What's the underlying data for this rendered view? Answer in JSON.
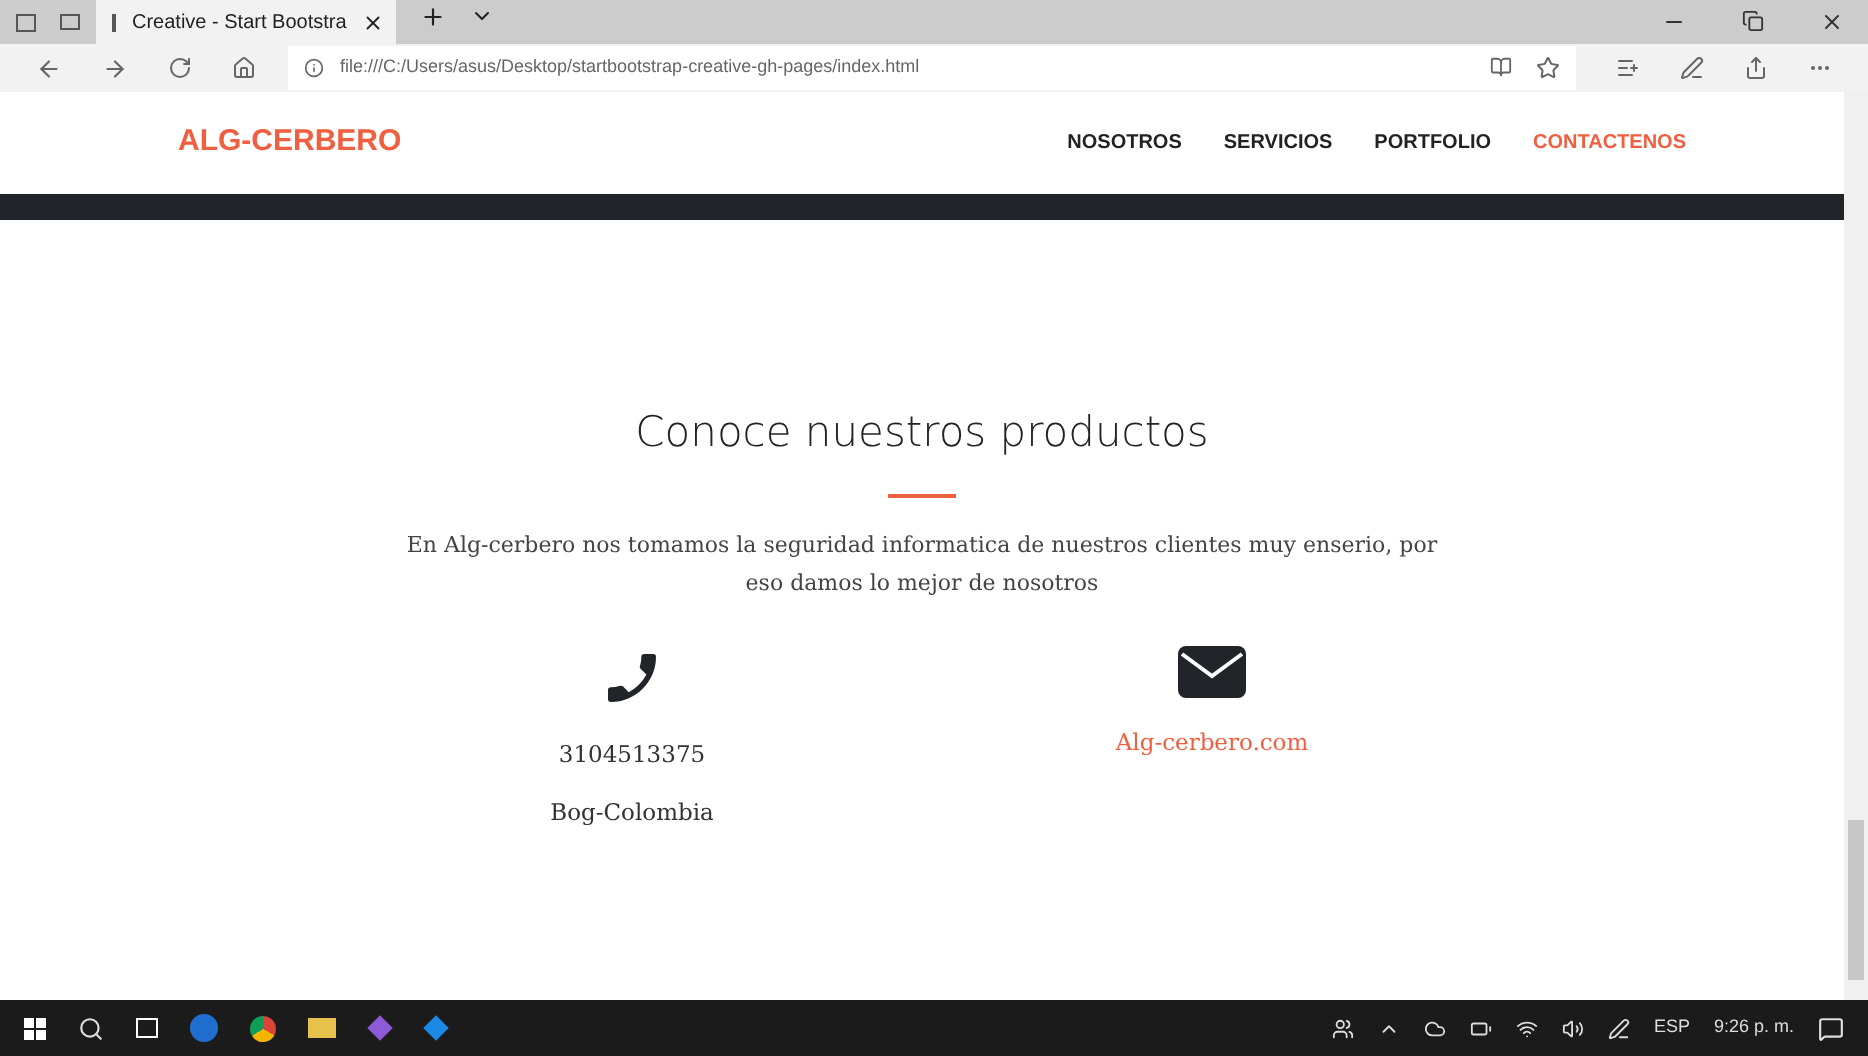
{
  "browser": {
    "tabs": [
      {
        "title": "Creative - Start Bootstra",
        "selected": true
      }
    ],
    "address": "file:///C:/Users/asus/Desktop/startbootstrap-creative-gh-pages/index.html"
  },
  "navbar": {
    "brand": "ALG-CERBERO",
    "items": [
      {
        "label": "NOSOTROS",
        "selected": false
      },
      {
        "label": "SERVICIOS",
        "selected": false
      },
      {
        "label": "PORTFOLIO",
        "selected": false
      },
      {
        "label": "CONTACTENOS",
        "selected": true
      }
    ]
  },
  "section": {
    "heading": "Conoce nuestros productos",
    "text": "En Alg-cerbero nos tomamos la seguridad informatica de nuestros clientes muy enserio, por eso damos lo mejor de nosotros",
    "contacts": [
      {
        "kind": "phone",
        "lines": [
          "3104513375",
          "Bog-Colombia"
        ]
      },
      {
        "kind": "email",
        "link": "Alg-cerbero.com"
      }
    ]
  },
  "taskbar": {
    "language": "ESP",
    "time": "9:26 p. m."
  }
}
